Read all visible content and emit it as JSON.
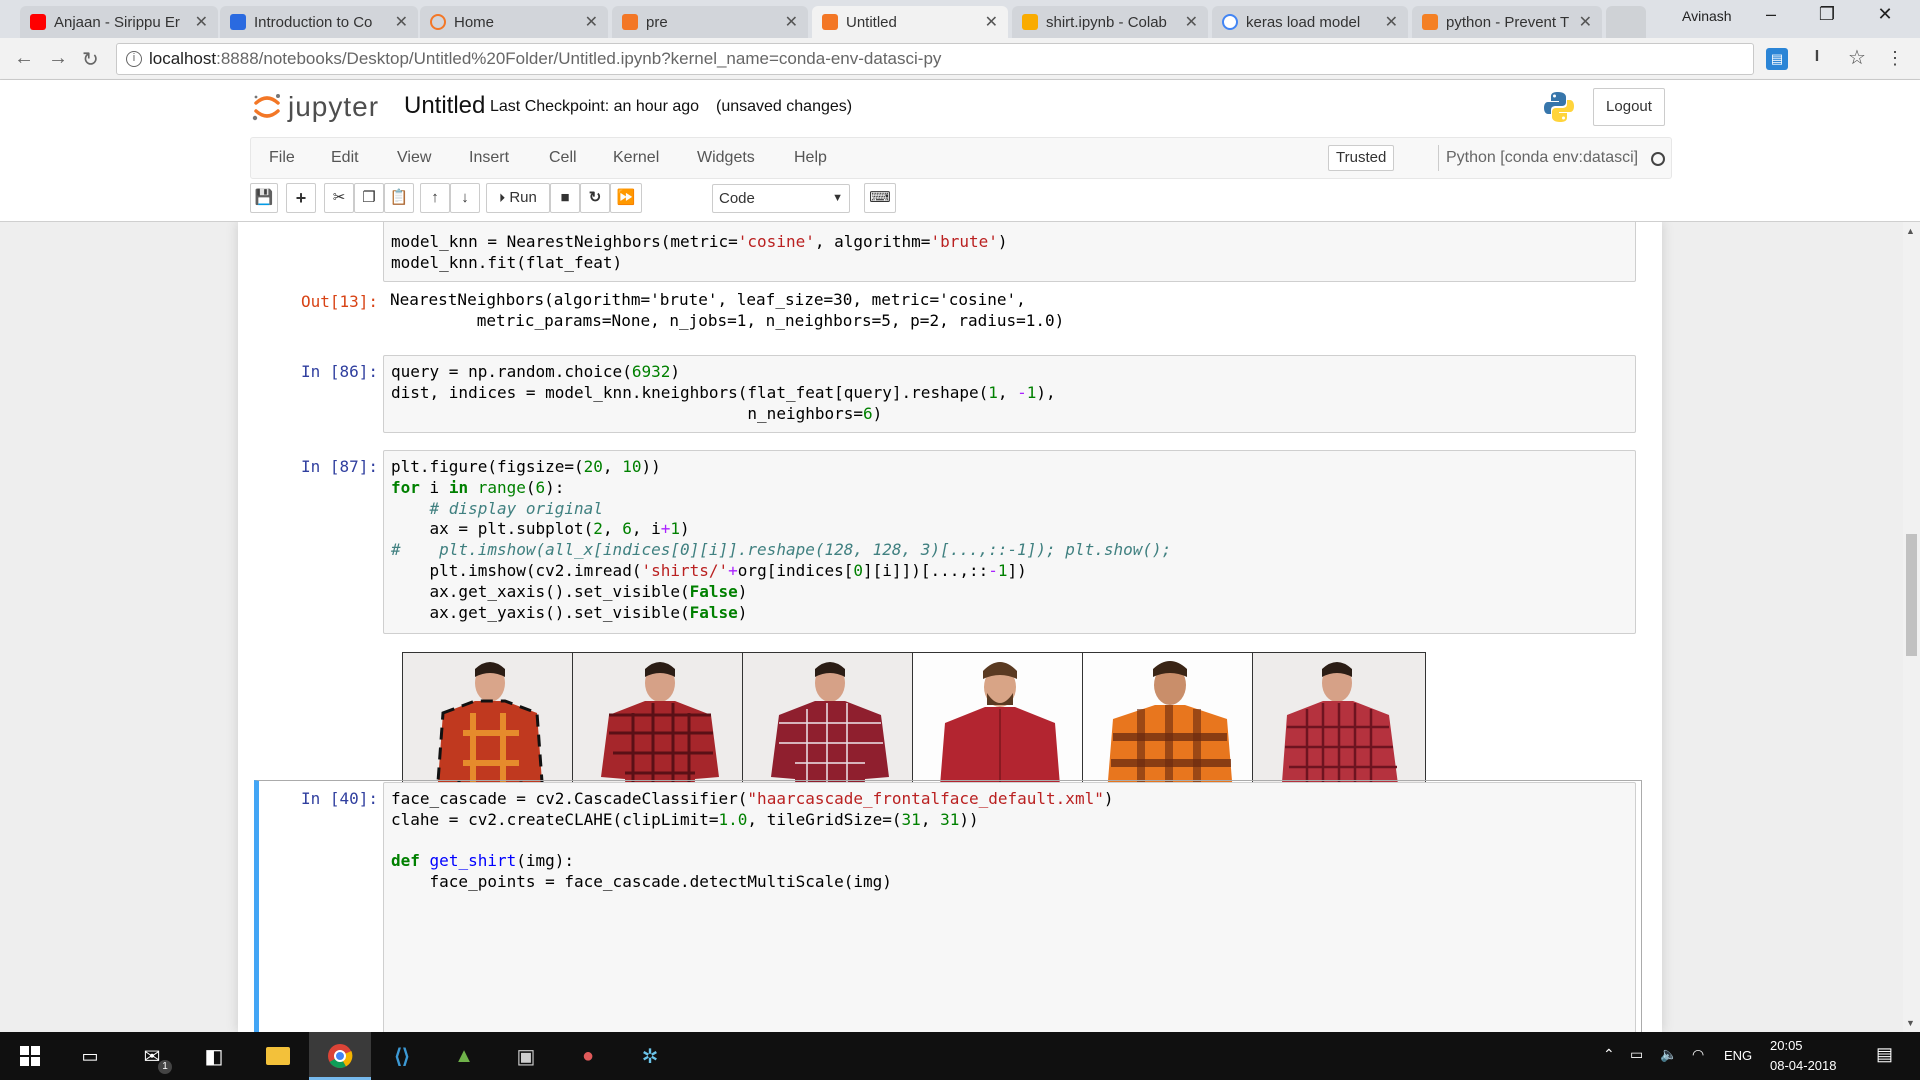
{
  "browser": {
    "tabs": [
      {
        "label": "Anjaan - Sirippu Er",
        "color": "#ff0000",
        "active": false
      },
      {
        "label": "Introduction to Co",
        "color": "#2a6ae0",
        "active": false
      },
      {
        "label": "Home",
        "color": "#f37726",
        "active": false
      },
      {
        "label": "pre",
        "color": "#f37726",
        "active": false
      },
      {
        "label": "Untitled",
        "color": "#f37726",
        "active": true
      },
      {
        "label": "shirt.ipynb - Colab",
        "color": "#f9ab00",
        "active": false
      },
      {
        "label": "keras load model",
        "color": "#4285f4",
        "active": false
      },
      {
        "label": "python - Prevent T",
        "color": "#f48024",
        "active": false
      }
    ],
    "user_name": "Avinash",
    "url_host": "localhost",
    "url_rest": ":8888/notebooks/Desktop/Untitled%20Folder/Untitled.ipynb?kernel_name=conda-env-datasci-py"
  },
  "jupyter": {
    "logo_text": "jupyter",
    "notebook_title": "Untitled",
    "checkpoint": "Last Checkpoint: an hour ago",
    "unsaved": "(unsaved changes)",
    "logout": "Logout",
    "menu": [
      "File",
      "Edit",
      "View",
      "Insert",
      "Cell",
      "Kernel",
      "Widgets",
      "Help"
    ],
    "trusted": "Trusted",
    "kernel": "Python [conda env:datasci]",
    "toolbar": {
      "run_label": "Run",
      "cell_type": "Code"
    }
  },
  "cells": {
    "c13_prompt": "Out[13]:",
    "c86_prompt": "In [86]:",
    "c87_prompt": "In [87]:",
    "c40_prompt": "In [40]:",
    "c13_output": "NearestNeighbors(algorithm='brute', leaf_size=30, metric='cosine',\n         metric_params=None, n_jobs=1, n_neighbors=5, p=2, radius=1.0)"
  },
  "taskbar": {
    "language": "ENG",
    "time": "20:05",
    "date": "08-04-2018",
    "mail_badge": "1"
  }
}
